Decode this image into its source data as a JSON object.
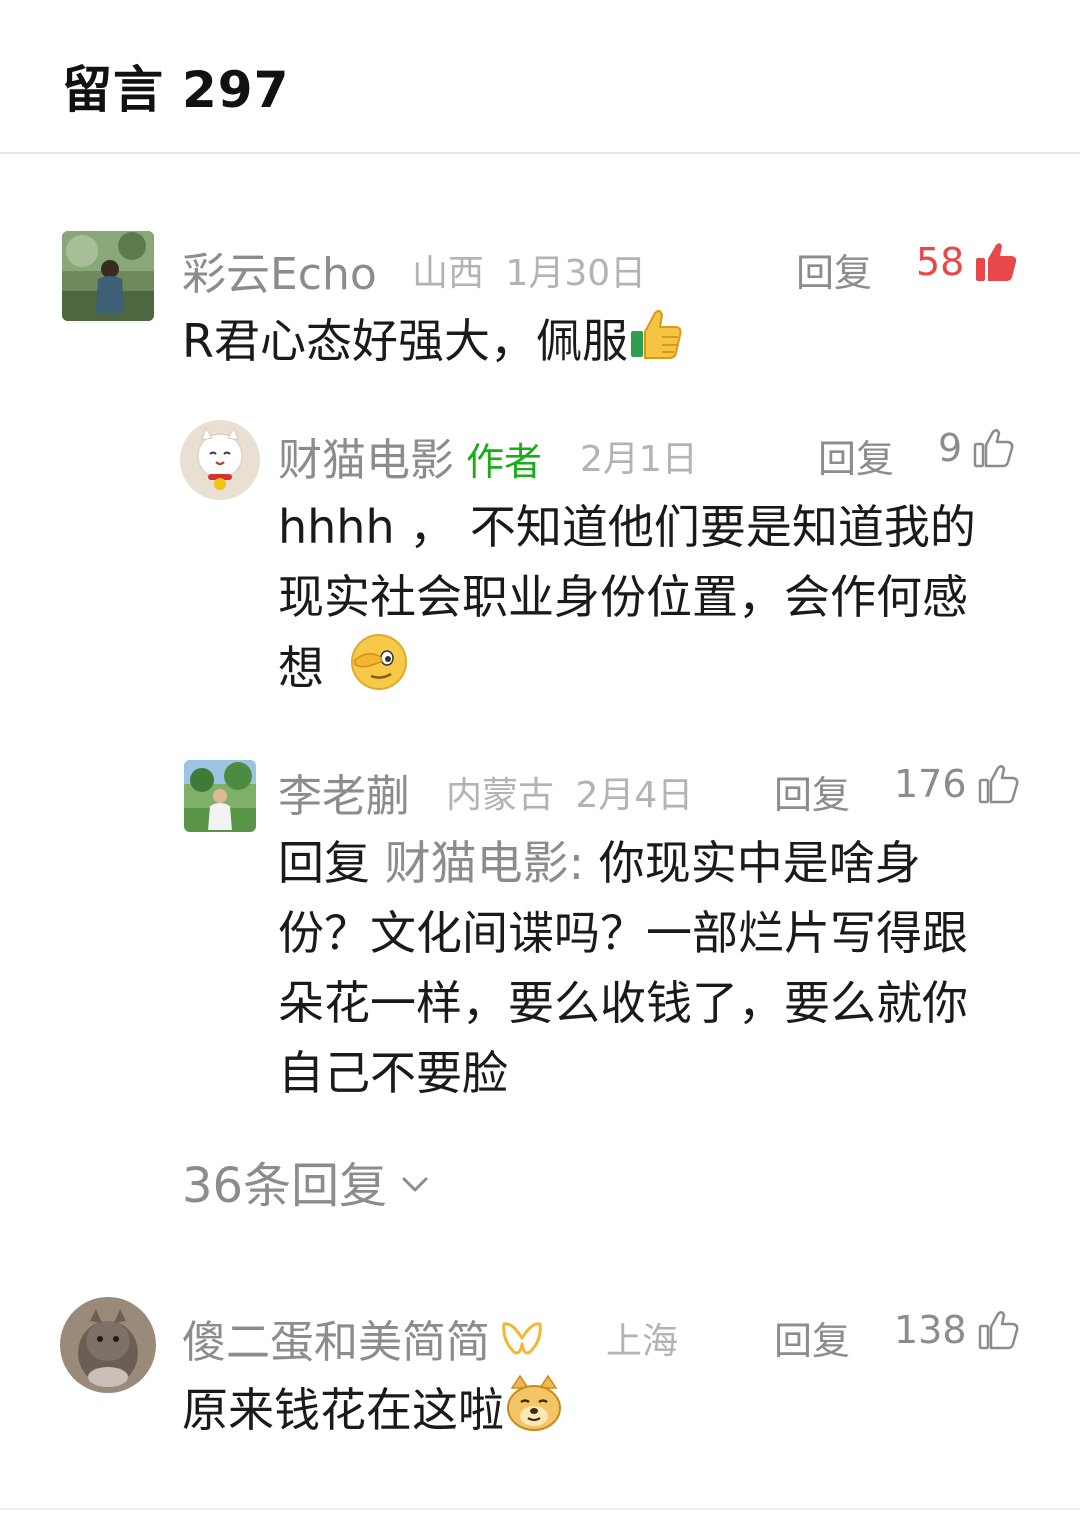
{
  "header": {
    "title": "留言",
    "count": "297"
  },
  "comments": [
    {
      "name": "彩云Echo",
      "location": "山西",
      "date": "1月30日",
      "reply_label": "回复",
      "likes": "58",
      "liked": true,
      "text": "R君心态好强大，佩服",
      "emoji": "thumbs-up"
    },
    {
      "name": "财猫电影",
      "badge": "作者",
      "date": "2月1日",
      "reply_label": "回复",
      "likes": "9",
      "text_lines": [
        "hhhh ， 不知道他们要是知道我的",
        "现实社会职业身份位置，会作何感",
        "想"
      ],
      "emoji": "face-with-hand-over-eye"
    },
    {
      "name": "李老蒯",
      "location": "内蒙古",
      "date": "2月4日",
      "reply_label": "回复",
      "likes": "176",
      "reply_prefix": "回复",
      "reply_target": "财猫电影:",
      "text_lines": [
        "你现实中是啥身",
        "份？文化间谍吗？一部烂片写得跟",
        "朵花一样，要么收钱了，要么就你",
        "自己不要脸"
      ]
    },
    {
      "name": "傻二蛋和美简简",
      "location": "上海",
      "reply_label": "回复",
      "likes": "138",
      "text": "原来钱花在这啦",
      "emoji": "doge"
    }
  ],
  "more_replies": "36条回复",
  "colors": {
    "liked": "#e8474b",
    "author": "#1aad19",
    "muted": "#8c8c8c",
    "meta": "#b3b3b3"
  }
}
